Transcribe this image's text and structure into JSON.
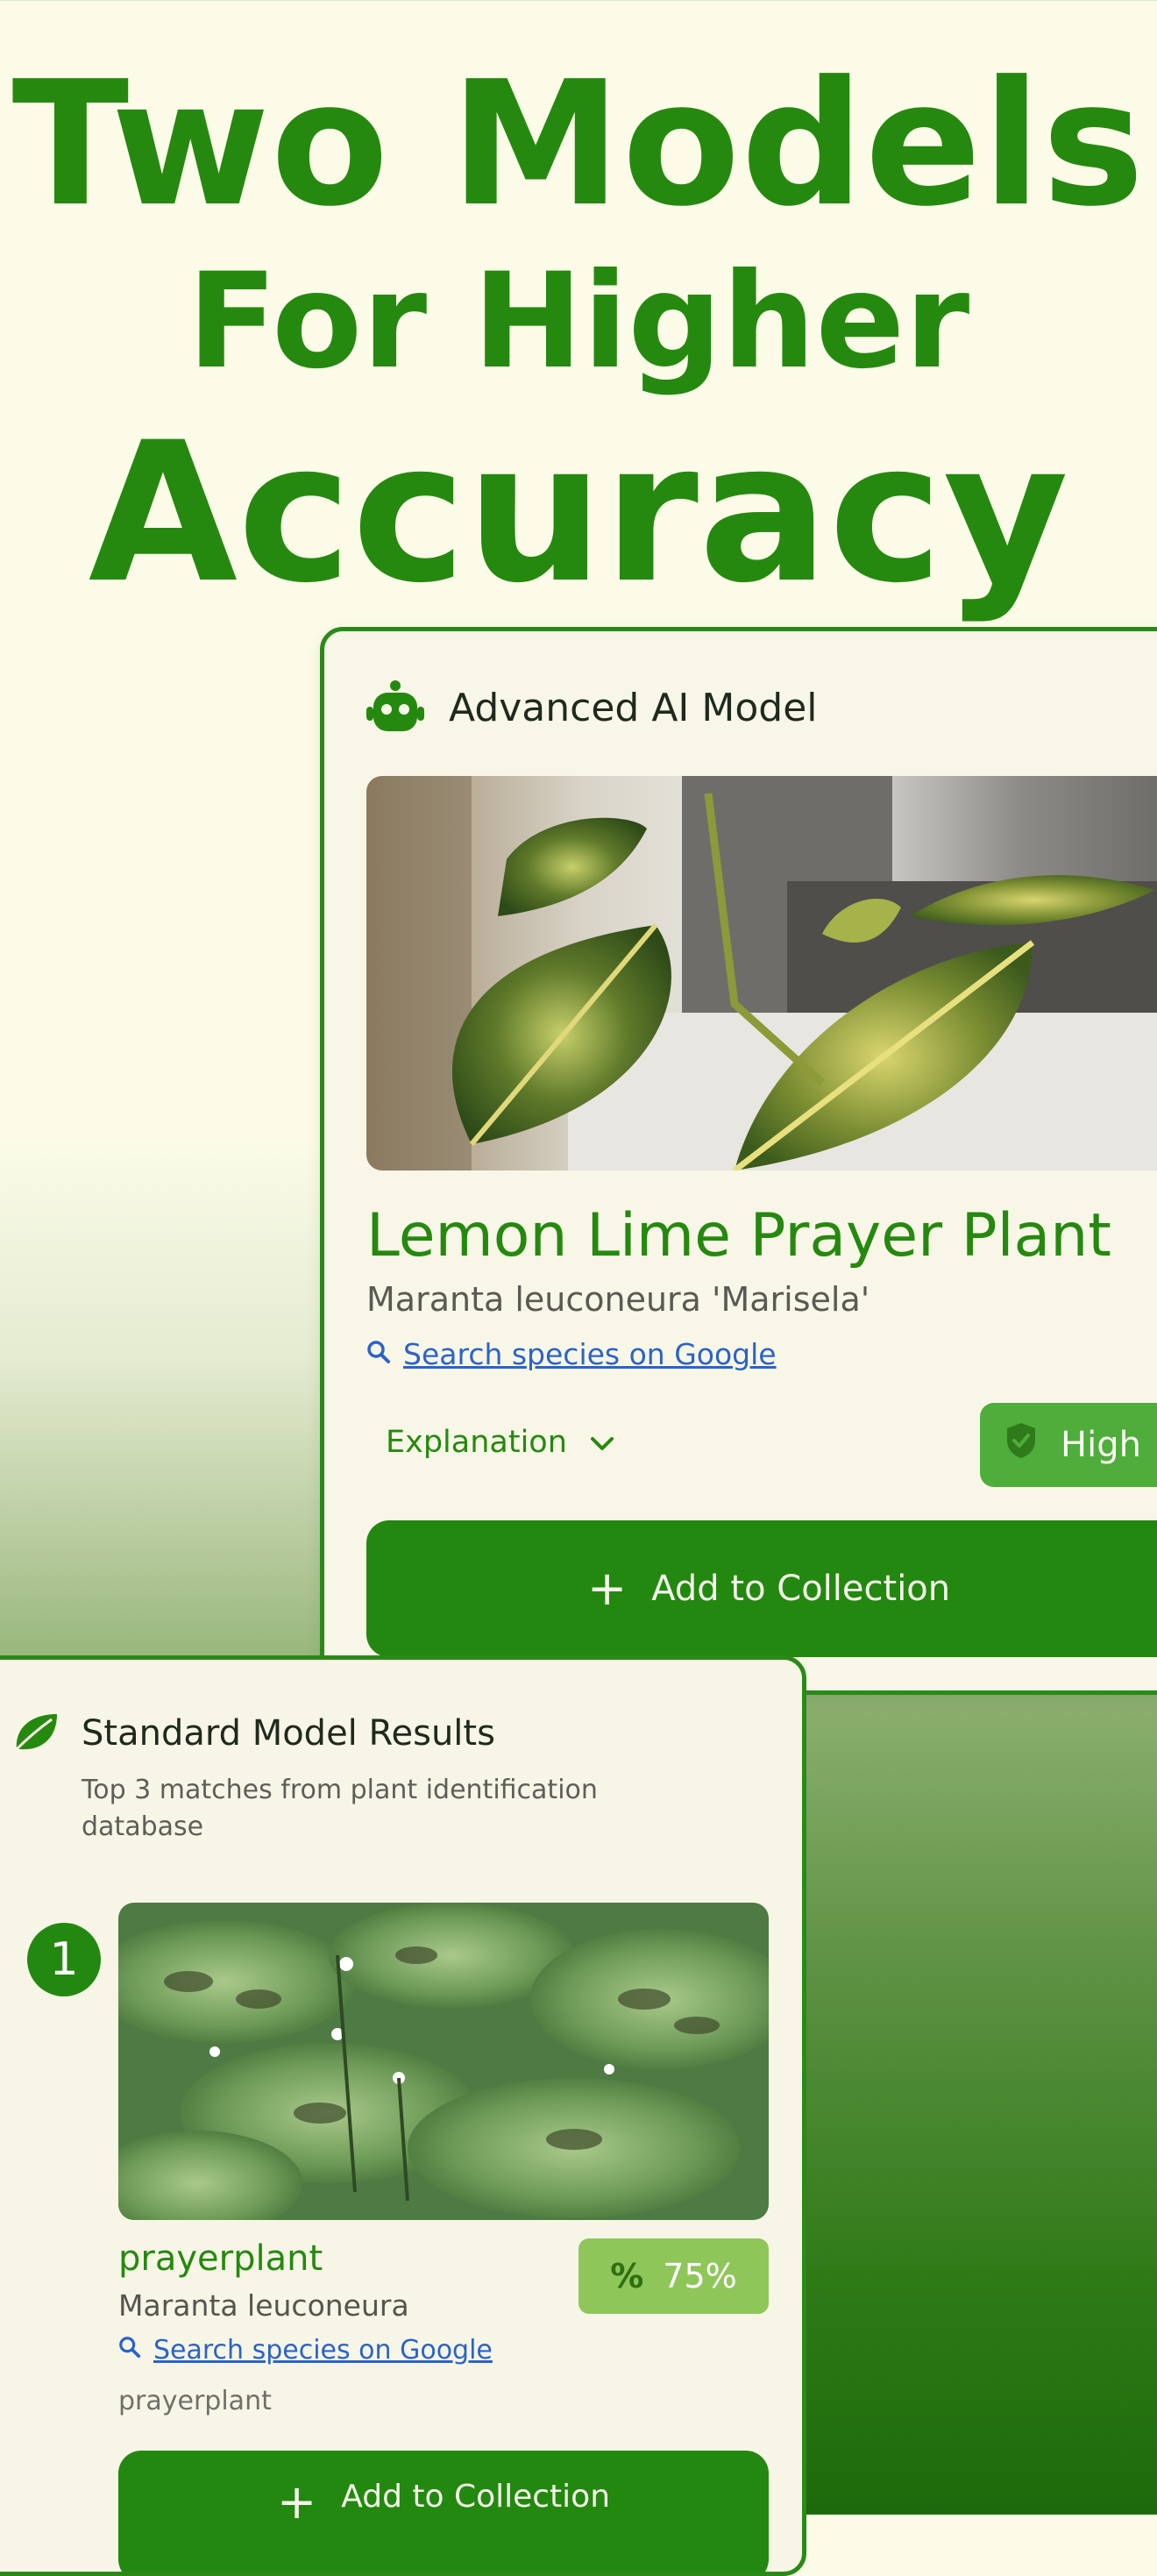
{
  "headline": {
    "line1": "Two Models",
    "line2": "For Higher",
    "line3": "Accuracy"
  },
  "advanced": {
    "title": "Advanced AI Model",
    "icon": "robot-icon",
    "plant_name": "Lemon Lime Prayer Plant",
    "scientific_name": "Maranta leuconeura 'Marisela'",
    "search_link": "Search species on Google",
    "explanation_label": "Explanation",
    "confidence_label": "High",
    "add_button": "Add to Collection"
  },
  "standard": {
    "title": "Standard Model Results",
    "icon": "leaf-icon",
    "subtitle": "Top 3 matches from plant identification database",
    "results": [
      {
        "rank": "1",
        "name": "prayerplant",
        "scientific_name": "Maranta leuconeura",
        "search_link": "Search species on Google",
        "extra": "prayerplant",
        "confidence": "75%",
        "add_button": "Add to Collection"
      }
    ]
  },
  "colors": {
    "brand_green": "#26890f",
    "button_green": "#23880f",
    "badge_green": "#4ead3b",
    "percent_badge": "#8fc65a",
    "link_blue": "#2b63c8"
  }
}
